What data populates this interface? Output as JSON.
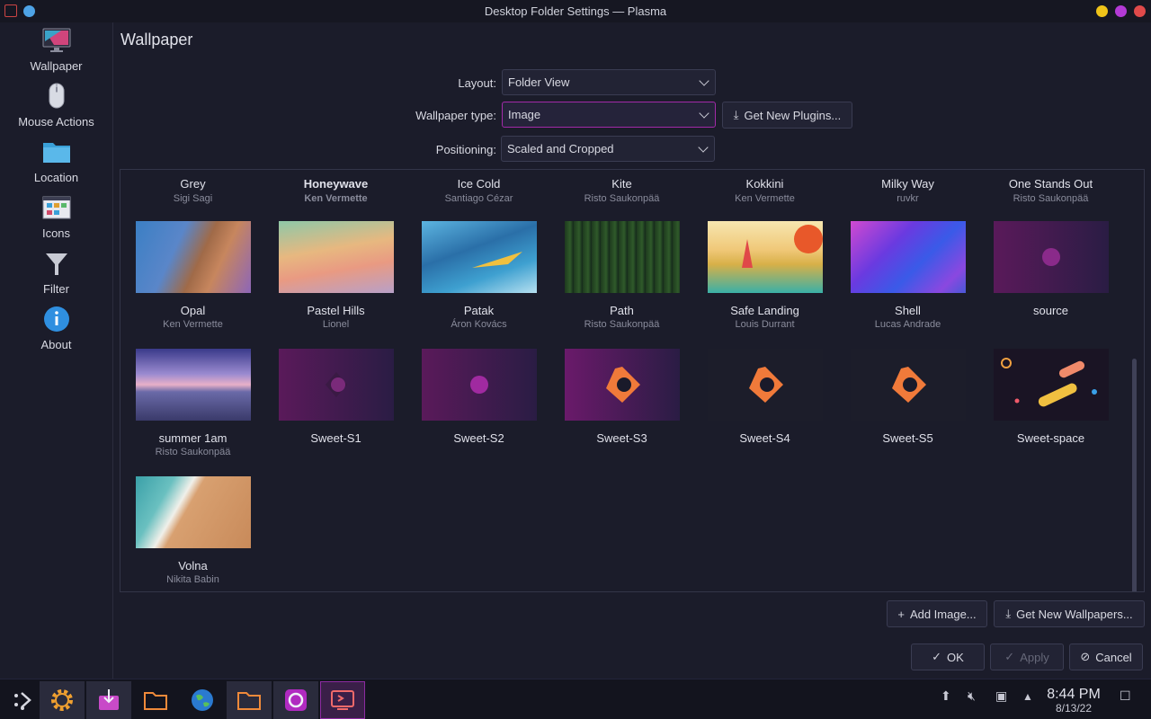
{
  "window": {
    "title": "Desktop Folder Settings — Plasma"
  },
  "sidebar": {
    "items": [
      {
        "label": "Wallpaper",
        "icon": "monitor-icon"
      },
      {
        "label": "Mouse Actions",
        "icon": "mouse-icon"
      },
      {
        "label": "Location",
        "icon": "folder-icon"
      },
      {
        "label": "Icons",
        "icon": "icons-grid-icon"
      },
      {
        "label": "Filter",
        "icon": "filter-icon"
      },
      {
        "label": "About",
        "icon": "info-icon"
      }
    ]
  },
  "main": {
    "title": "Wallpaper",
    "layout": {
      "label": "Layout:",
      "value": "Folder View"
    },
    "wallpaper_type": {
      "label": "Wallpaper type:",
      "value": "Image"
    },
    "get_plugins_label": "Get New Plugins...",
    "positioning": {
      "label": "Positioning:",
      "value": "Scaled and Cropped"
    }
  },
  "wallpapers_top": [
    {
      "name": "Grey",
      "author": "Sigi Sagi"
    },
    {
      "name": "Honeywave",
      "author": "Ken Vermette",
      "selected": true
    },
    {
      "name": "Ice Cold",
      "author": "Santiago Cézar"
    },
    {
      "name": "Kite",
      "author": "Risto Saukonpää"
    },
    {
      "name": "Kokkini",
      "author": "Ken Vermette"
    },
    {
      "name": "Milky Way",
      "author": "ruvkr"
    },
    {
      "name": "One Stands Out",
      "author": "Risto Saukonpää"
    }
  ],
  "wallpapers": [
    {
      "name": "Opal",
      "author": "Ken Vermette"
    },
    {
      "name": "Pastel Hills",
      "author": "Lionel"
    },
    {
      "name": "Patak",
      "author": "Áron Kovács"
    },
    {
      "name": "Path",
      "author": "Risto Saukonpää"
    },
    {
      "name": "Safe Landing",
      "author": "Louis Durrant"
    },
    {
      "name": "Shell",
      "author": "Lucas Andrade"
    },
    {
      "name": "source",
      "author": ""
    },
    {
      "name": "summer 1am",
      "author": "Risto Saukonpää"
    },
    {
      "name": "Sweet-S1",
      "author": ""
    },
    {
      "name": "Sweet-S2",
      "author": ""
    },
    {
      "name": "Sweet-S3",
      "author": ""
    },
    {
      "name": "Sweet-S4",
      "author": ""
    },
    {
      "name": "Sweet-S5",
      "author": ""
    },
    {
      "name": "Sweet-space",
      "author": ""
    },
    {
      "name": "Volna",
      "author": "Nikita Babin"
    }
  ],
  "buttons": {
    "add_image": "Add Image...",
    "get_wallpapers": "Get New Wallpapers...",
    "ok": "OK",
    "apply": "Apply",
    "cancel": "Cancel"
  },
  "clock": {
    "time": "8:44 PM",
    "date": "8/13/22"
  },
  "colors": {
    "accent": "#a22aa8",
    "background": "#1b1c2a",
    "panel": "#13141e"
  }
}
